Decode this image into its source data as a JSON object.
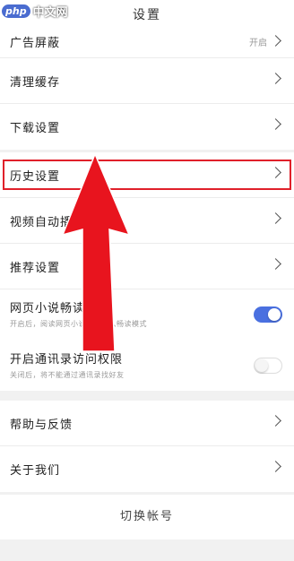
{
  "header": {
    "title": "设置",
    "watermark_logo": "php",
    "watermark_text": "中文网"
  },
  "group1": [
    {
      "label": "广告屏蔽",
      "value": "开启"
    },
    {
      "label": "清理缓存"
    },
    {
      "label": "下载设置"
    }
  ],
  "group2": [
    {
      "label": "历史设置"
    },
    {
      "label": "视频自动播放"
    },
    {
      "label": "推荐设置"
    }
  ],
  "novel": {
    "label": "网页小说畅读服务",
    "sub": "开启后，阅读网页小说时会进入畅读模式",
    "enabled": true
  },
  "contacts": {
    "label": "开启通讯录访问权限",
    "sub": "关闭后，将不能通过通讯录找好友",
    "enabled": false
  },
  "group3": [
    {
      "label": "帮助与反馈"
    },
    {
      "label": "关于我们"
    }
  ],
  "footer": {
    "switch_account": "切换帐号"
  },
  "colors": {
    "highlight": "#e0202a",
    "arrow": "#e8141e",
    "toggle_on": "#4a70e0"
  }
}
